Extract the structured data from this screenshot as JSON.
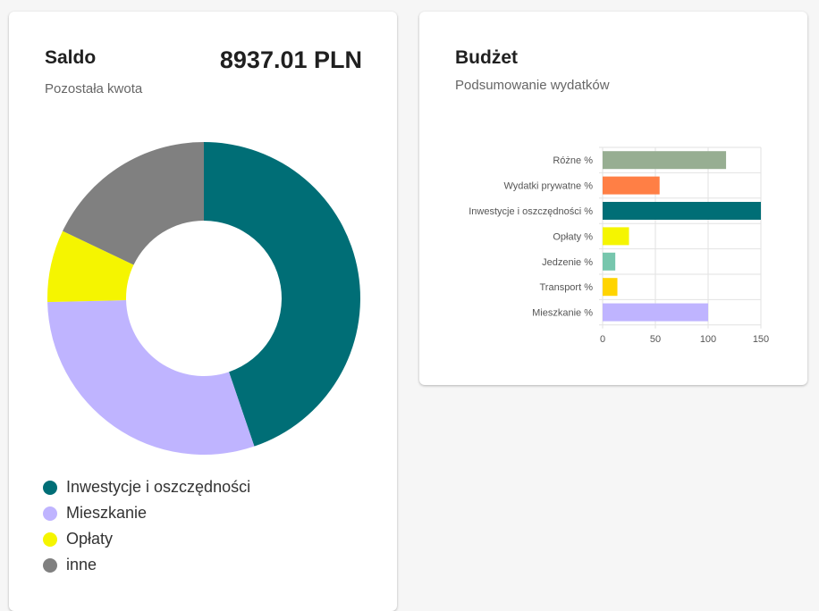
{
  "saldo": {
    "title": "Saldo",
    "subtitle": "Pozostała kwota",
    "amount": "8937.01 PLN"
  },
  "budzet": {
    "title": "Budżet",
    "subtitle": "Podsumowanie wydatków"
  },
  "chart_data": [
    {
      "type": "pie",
      "donut": true,
      "labels": [
        "Inwestycje i oszczędności",
        "Mieszkanie",
        "Opłaty",
        "inne"
      ],
      "values": [
        150,
        100,
        25,
        60
      ],
      "colors": [
        "#006e76",
        "#bfb4ff",
        "#f5f500",
        "#808080"
      ],
      "legend_position": "bottom"
    },
    {
      "type": "bar",
      "orientation": "horizontal",
      "categories": [
        "Różne %",
        "Wydatki prywatne %",
        "Inwestycje i oszczędności %",
        "Opłaty %",
        "Jedzenie %",
        "Transport %",
        "Mieszkanie %"
      ],
      "values": [
        117,
        54,
        150,
        25,
        12,
        14,
        100
      ],
      "colors": [
        "#97ae92",
        "#ff7f45",
        "#006e76",
        "#f5f500",
        "#77c6ad",
        "#ffd400",
        "#bfb4ff"
      ],
      "xlim": [
        0,
        150
      ],
      "xticks": [
        0,
        50,
        100,
        150
      ],
      "grid": true
    }
  ]
}
